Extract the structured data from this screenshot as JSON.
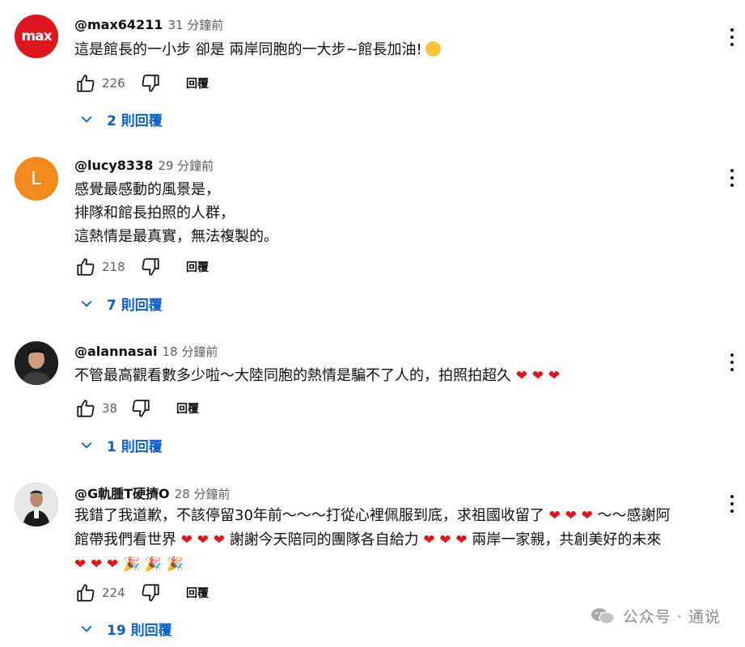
{
  "comments": [
    {
      "handle": "@max64211",
      "time": "31 分鐘前",
      "avatar_text": "max",
      "lines": [
        "這是館長的一小步 卻是 兩岸同胞的一大步~館長加油!"
      ],
      "likes": "226",
      "reply_label": "回覆",
      "replies": "2 則回覆"
    },
    {
      "handle": "@lucy8338",
      "time": "29 分鐘前",
      "avatar_text": "L",
      "lines": [
        "感覺最感動的風景是，",
        "排隊和館長拍照的人群，",
        "這熱情是最真實，無法複製的。"
      ],
      "likes": "218",
      "reply_label": "回覆",
      "replies": "7 則回覆"
    },
    {
      "handle": "@alannasai",
      "time": "18 分鐘前",
      "lines": [
        "不管最高觀看數多少啦～大陸同胞的熱情是騙不了人的，拍照拍超久"
      ],
      "likes": "38",
      "reply_label": "回覆",
      "replies": "1 則回覆"
    },
    {
      "handle": "@G軌腫T硬擠O",
      "time": "28 分鐘前",
      "lines": [
        "我錯了我道歉，不該停留30年前～～～打從心裡佩服到底，求祖國收留了",
        "～～感謝阿",
        "館帶我們看世界",
        "謝謝今天陪同的團隊各自給力",
        "兩岸一家親，共創美好的未來"
      ],
      "likes": "224",
      "reply_label": "回覆",
      "replies": "19 則回覆"
    }
  ],
  "watermark": "公众号 · 通说",
  "icons": {
    "like": "thumbs-up-icon",
    "dislike": "thumbs-down-icon",
    "expand": "chevron-down-icon",
    "menu": "more-vert-icon",
    "heart": "red-heart-emoji",
    "party": "party-popper-emoji",
    "hug": "hugging-face-emoji"
  },
  "colors": {
    "link_blue": "#065fd4",
    "meta_gray": "#606060",
    "max_red": "#e0161e",
    "lucy_orange": "#f08a1d"
  }
}
